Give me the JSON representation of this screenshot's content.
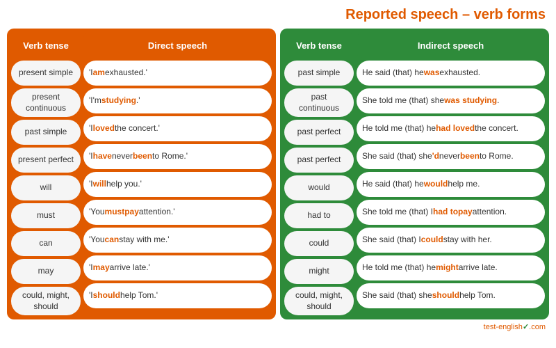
{
  "title": "Reported speech – verb forms",
  "left_header_verb": "Verb tense",
  "left_header_speech": "Direct speech",
  "right_header_verb": "Verb tense",
  "right_header_speech": "Indirect speech",
  "rows": [
    {
      "verb_tense": "present simple",
      "direct": [
        {
          "text": "'I "
        },
        {
          "text": "am",
          "class": "orange"
        },
        {
          "text": " exhausted.'"
        }
      ],
      "indirect_verb": "past simple",
      "indirect": [
        {
          "text": "He said (that) he "
        },
        {
          "text": "was",
          "class": "orange"
        },
        {
          "text": " exhausted."
        }
      ]
    },
    {
      "verb_tense": "present continuous",
      "direct": [
        {
          "text": "'I'm "
        },
        {
          "text": "studying",
          "class": "orange"
        },
        {
          "text": ".'"
        }
      ],
      "indirect_verb": "past continuous",
      "indirect": [
        {
          "text": "She told me (that) she "
        },
        {
          "text": "was studying",
          "class": "orange"
        },
        {
          "text": "."
        }
      ]
    },
    {
      "verb_tense": "past simple",
      "direct": [
        {
          "text": "'I "
        },
        {
          "text": "loved",
          "class": "orange"
        },
        {
          "text": " the concert.'"
        }
      ],
      "indirect_verb": "past perfect",
      "indirect": [
        {
          "text": "He told me (that) he "
        },
        {
          "text": "had loved",
          "class": "orange"
        },
        {
          "text": " the concert."
        }
      ]
    },
    {
      "verb_tense": "present perfect",
      "direct": [
        {
          "text": "'I "
        },
        {
          "text": "have",
          "class": "orange"
        },
        {
          "text": " never "
        },
        {
          "text": "been",
          "class": "orange"
        },
        {
          "text": " to Rome.'"
        }
      ],
      "indirect_verb": "past perfect",
      "indirect": [
        {
          "text": "She said (that) she"
        },
        {
          "text": "'d",
          "class": "orange"
        },
        {
          "text": " never "
        },
        {
          "text": "been",
          "class": "orange"
        },
        {
          "text": " to Rome."
        }
      ]
    },
    {
      "verb_tense": "will",
      "direct": [
        {
          "text": "'I "
        },
        {
          "text": "will",
          "class": "orange"
        },
        {
          "text": " help you.'"
        }
      ],
      "indirect_verb": "would",
      "indirect": [
        {
          "text": "He said (that) he "
        },
        {
          "text": "would",
          "class": "orange"
        },
        {
          "text": " help me."
        }
      ]
    },
    {
      "verb_tense": "must",
      "direct": [
        {
          "text": "'You "
        },
        {
          "text": "must",
          "class": "orange"
        },
        {
          "text": " "
        },
        {
          "text": "pay",
          "class": "orange"
        },
        {
          "text": " attention.'"
        }
      ],
      "indirect_verb": "had to",
      "indirect": [
        {
          "text": "She told me (that) I "
        },
        {
          "text": "had to",
          "class": "orange"
        },
        {
          "text": " "
        },
        {
          "text": "pay",
          "class": "orange"
        },
        {
          "text": " attention."
        }
      ]
    },
    {
      "verb_tense": "can",
      "direct": [
        {
          "text": "'You "
        },
        {
          "text": "can",
          "class": "orange"
        },
        {
          "text": " stay with me.'"
        }
      ],
      "indirect_verb": "could",
      "indirect": [
        {
          "text": "She said (that) I "
        },
        {
          "text": "could",
          "class": "orange"
        },
        {
          "text": " stay with her."
        }
      ]
    },
    {
      "verb_tense": "may",
      "direct": [
        {
          "text": "'I "
        },
        {
          "text": "may",
          "class": "orange"
        },
        {
          "text": " arrive late.'"
        }
      ],
      "indirect_verb": "might",
      "indirect": [
        {
          "text": "He told me (that) he "
        },
        {
          "text": "might",
          "class": "orange"
        },
        {
          "text": " arrive late."
        }
      ]
    },
    {
      "verb_tense": "could, might, should",
      "direct": [
        {
          "text": "'I "
        },
        {
          "text": "should",
          "class": "orange"
        },
        {
          "text": " help Tom.'"
        }
      ],
      "indirect_verb": "could, might, should",
      "indirect": [
        {
          "text": "She said (that) she "
        },
        {
          "text": "should",
          "class": "orange"
        },
        {
          "text": " help Tom."
        }
      ]
    }
  ],
  "footer": "test-english",
  "footer_dot": "✓",
  "footer_com": ".com"
}
